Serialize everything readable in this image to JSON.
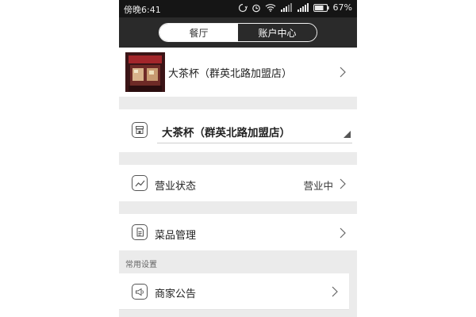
{
  "status_bar": {
    "time": "傍晚6:41",
    "battery": "67%",
    "icons": [
      "rotation-lock-icon",
      "alarm-icon",
      "wifi-icon",
      "mobile-data-icon",
      "signal-icon",
      "battery-icon"
    ]
  },
  "header": {
    "tabs": [
      {
        "label": "餐厅",
        "active": true
      },
      {
        "label": "账户中心",
        "active": false
      }
    ]
  },
  "store_row": {
    "name": "大茶杯（群英北路加盟店）",
    "photo_icon": "store-photo"
  },
  "store_selector": {
    "selected": "大茶杯（群英北路加盟店）",
    "icon": "store-icon"
  },
  "business_status": {
    "label": "营业状态",
    "value": "营业中",
    "icon": "trend-chart-icon"
  },
  "menu_management": {
    "label": "菜品管理",
    "icon": "document-icon"
  },
  "common_settings": {
    "section_title": "常用设置",
    "items": [
      {
        "label": "商家公告",
        "icon": "megaphone-icon"
      }
    ]
  },
  "colors": {
    "header_bg": "#2a2a2a",
    "status_bar_bg": "#151515",
    "page_bg": "#ebebeb",
    "row_bg": "#ffffff"
  }
}
